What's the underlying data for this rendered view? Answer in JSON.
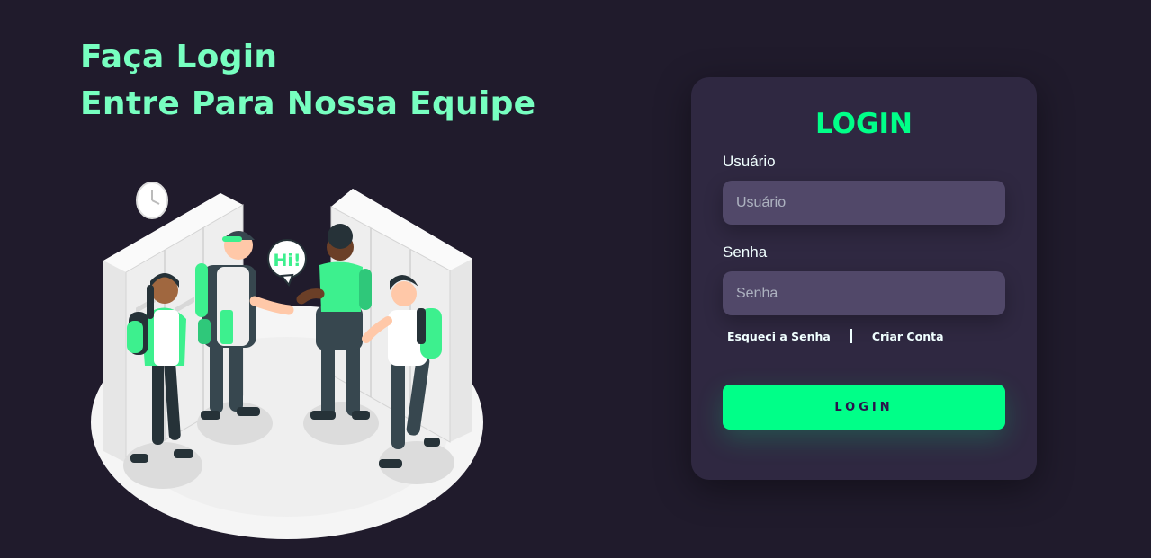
{
  "hero": {
    "line1": "Faça Login",
    "line2": "Entre Para Nossa Equipe"
  },
  "illustration": {
    "speech_bubble": "Hi!",
    "accent_color": "#3df08e"
  },
  "login_card": {
    "title": "LOGIN",
    "username": {
      "label": "Usuário",
      "placeholder": "Usuário",
      "value": ""
    },
    "password": {
      "label": "Senha",
      "placeholder": "Senha",
      "value": ""
    },
    "links": {
      "forgot_password": "Esqueci a Senha",
      "separator": "|",
      "create_account": "Criar Conta"
    },
    "submit_label": "LOGIN"
  },
  "colors": {
    "background": "#201b2c",
    "card": "#2f2841",
    "input": "#514869",
    "accent": "#00ff88",
    "hero_text": "#77ffc0"
  }
}
